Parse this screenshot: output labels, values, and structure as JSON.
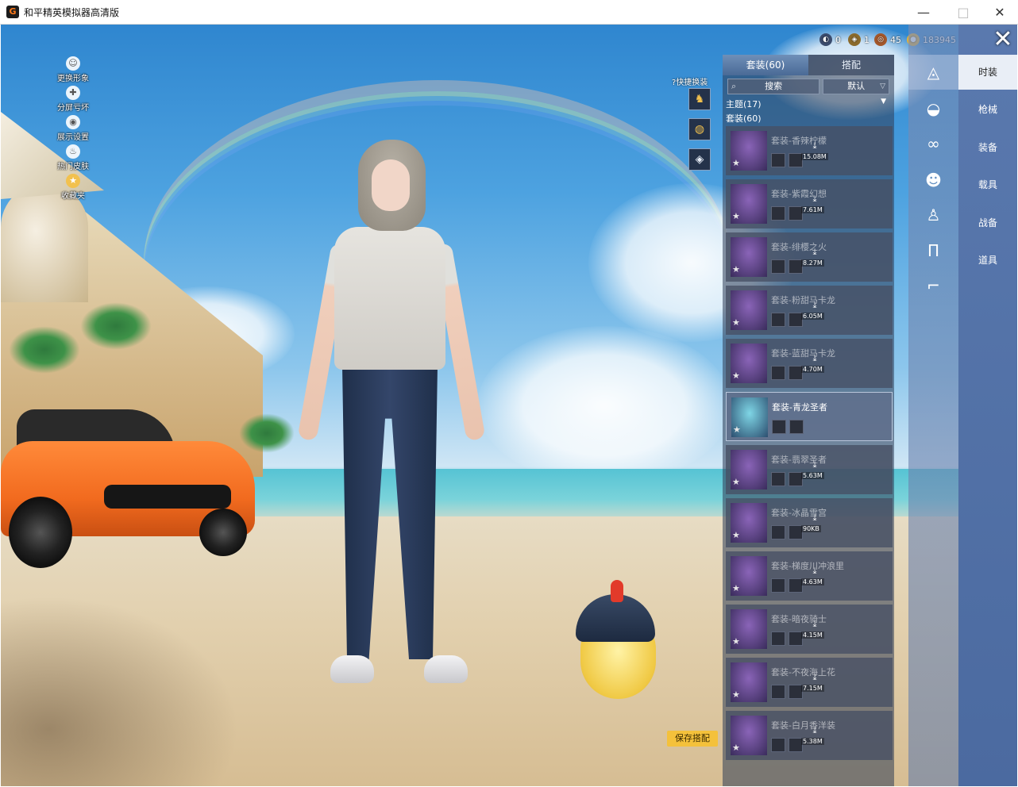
{
  "window": {
    "title": "和平精英模拟器高清版",
    "app_icon_glyph": "G",
    "minimize": "—",
    "maximize": "□",
    "close": "✕"
  },
  "left_menu": [
    {
      "label": "更换形象",
      "icon": "user-icon"
    },
    {
      "label": "分屏亏坏",
      "icon": "split-icon"
    },
    {
      "label": "展示设置",
      "icon": "eye-icon"
    },
    {
      "label": "热门皮肤",
      "icon": "fire-icon"
    },
    {
      "label": "收藏夹",
      "icon": "star-icon"
    }
  ],
  "quick_switch": {
    "label": "快捷换装"
  },
  "currency": [
    {
      "icon": "rank-icon",
      "value": "0"
    },
    {
      "icon": "medal-icon",
      "value": "1"
    },
    {
      "icon": "coin-icon",
      "value": "45"
    },
    {
      "icon": "gold-icon",
      "value": "183945"
    }
  ],
  "panel": {
    "tabs": [
      "套装(60)",
      "搭配"
    ],
    "search_label": "搜索",
    "sort_label": "默认",
    "theme_label": "主题(17)",
    "count_label": "套装(60)"
  },
  "cards": [
    {
      "name": "套装-香辣柠檬",
      "size": "15.08M",
      "selected": false
    },
    {
      "name": "套装-紫霞幻想",
      "size": "7.61M",
      "selected": false
    },
    {
      "name": "套装-绯樱之火",
      "size": "8.27M",
      "selected": false
    },
    {
      "name": "套装-粉甜马卡龙",
      "size": "6.05M",
      "selected": false
    },
    {
      "name": "套装-蓝甜马卡龙",
      "size": "4.70M",
      "selected": false
    },
    {
      "name": "套装-青龙圣者",
      "size": "",
      "selected": true
    },
    {
      "name": "套装-翡翠圣者",
      "size": "5.63M",
      "selected": false
    },
    {
      "name": "套装-冰晶雪宫",
      "size": "90KB",
      "selected": false
    },
    {
      "name": "套装-梯度川冲浪里",
      "size": "4.63M",
      "selected": false
    },
    {
      "name": "套装-暗夜骑士",
      "size": "4.15M",
      "selected": false
    },
    {
      "name": "套装-不夜海上花",
      "size": "7.15M",
      "selected": false
    },
    {
      "name": "套装-白月香洋装",
      "size": "5.38M",
      "selected": false
    }
  ],
  "save_button": "保存搭配",
  "categories": [
    {
      "label": "时装",
      "icon": "hanger-icon",
      "glyph": "◬",
      "active": true
    },
    {
      "label": "枪械",
      "icon": "cap-icon",
      "glyph": "◒",
      "active": false
    },
    {
      "label": "装备",
      "icon": "goggles-icon",
      "glyph": "∞",
      "active": false
    },
    {
      "label": "载具",
      "icon": "mask-icon",
      "glyph": "☻",
      "active": false
    },
    {
      "label": "战备",
      "icon": "jacket-icon",
      "glyph": "♙",
      "active": false
    },
    {
      "label": "道具",
      "icon": "pants-icon",
      "glyph": "Π",
      "active": false
    },
    {
      "label": "",
      "icon": "shoes-icon",
      "glyph": "⌐",
      "active": false
    }
  ],
  "colors": {
    "accent": "#f4c13b",
    "nav": "#5a79ae",
    "car": "#f26b1f"
  }
}
